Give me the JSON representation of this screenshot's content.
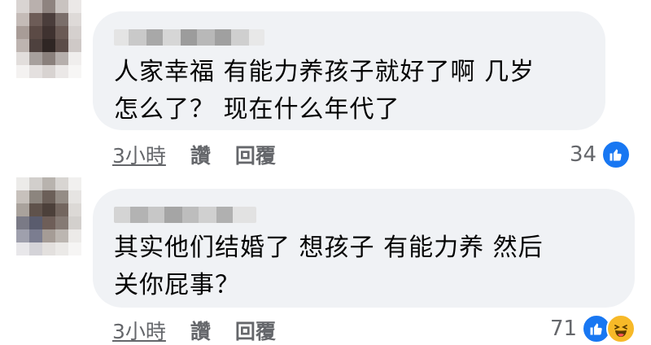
{
  "comments": [
    {
      "text": "人家幸福 有能力养孩子就好了啊 几岁\n怎么了？ 现在什么年代了",
      "time": "3小時",
      "like_label": "讚",
      "reply_label": "回覆",
      "reaction_count": "34",
      "reactions": [
        "like-icon"
      ]
    },
    {
      "text": "其实他们结婚了 想孩子 有能力养 然后\n关你屁事？",
      "time": "3小時",
      "like_label": "讚",
      "reply_label": "回覆",
      "reaction_count": "71",
      "reactions": [
        "like-icon",
        "haha-icon"
      ]
    }
  ],
  "colors": {
    "bubble": "#f0f2f5",
    "meta_text": "#65676b",
    "like_blue": "#1877f2",
    "haha_yellow": "#f7b928"
  }
}
